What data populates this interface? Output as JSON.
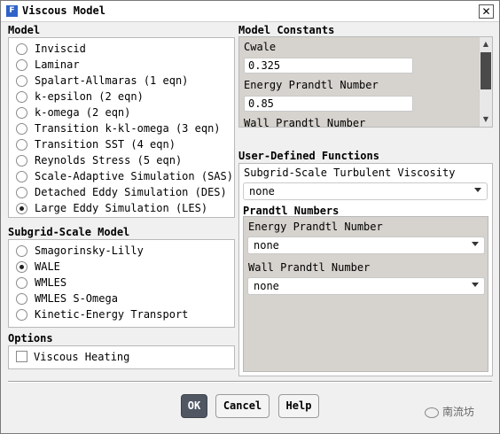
{
  "window": {
    "title": "Viscous Model",
    "icon_letter": "F",
    "close_glyph": "✕"
  },
  "model": {
    "title": "Model",
    "options": [
      {
        "label": "Inviscid",
        "checked": false
      },
      {
        "label": "Laminar",
        "checked": false
      },
      {
        "label": "Spalart-Allmaras (1 eqn)",
        "checked": false
      },
      {
        "label": "k-epsilon (2 eqn)",
        "checked": false
      },
      {
        "label": "k-omega (2 eqn)",
        "checked": false
      },
      {
        "label": "Transition k-kl-omega (3 eqn)",
        "checked": false
      },
      {
        "label": "Transition SST (4 eqn)",
        "checked": false
      },
      {
        "label": "Reynolds Stress (5 eqn)",
        "checked": false
      },
      {
        "label": "Scale-Adaptive Simulation (SAS)",
        "checked": false
      },
      {
        "label": "Detached Eddy Simulation (DES)",
        "checked": false
      },
      {
        "label": "Large Eddy Simulation (LES)",
        "checked": true
      }
    ]
  },
  "subgrid": {
    "title": "Subgrid-Scale Model",
    "options": [
      {
        "label": "Smagorinsky-Lilly",
        "checked": false
      },
      {
        "label": "WALE",
        "checked": true
      },
      {
        "label": "WMLES",
        "checked": false
      },
      {
        "label": "WMLES S-Omega",
        "checked": false
      },
      {
        "label": "Kinetic-Energy Transport",
        "checked": false
      }
    ]
  },
  "options": {
    "title": "Options",
    "viscous_heating_label": "Viscous Heating",
    "viscous_heating_checked": false
  },
  "constants": {
    "title": "Model Constants",
    "cwale_label": "Cwale",
    "cwale_value": "0.325",
    "energy_prandtl_label": "Energy Prandtl Number",
    "energy_prandtl_value": "0.85",
    "wall_prandtl_label": "Wall Prandtl Number"
  },
  "udf": {
    "title": "User-Defined Functions",
    "subgrid_visc_label": "Subgrid-Scale Turbulent Viscosity",
    "subgrid_visc_value": "none",
    "prandtl_title": "Prandtl Numbers",
    "energy_prandtl_label": "Energy Prandtl Number",
    "energy_prandtl_value": "none",
    "wall_prandtl_label": "Wall Prandtl Number",
    "wall_prandtl_value": "none"
  },
  "buttons": {
    "ok": "OK",
    "cancel": "Cancel",
    "help": "Help"
  },
  "watermark": "南流坊"
}
